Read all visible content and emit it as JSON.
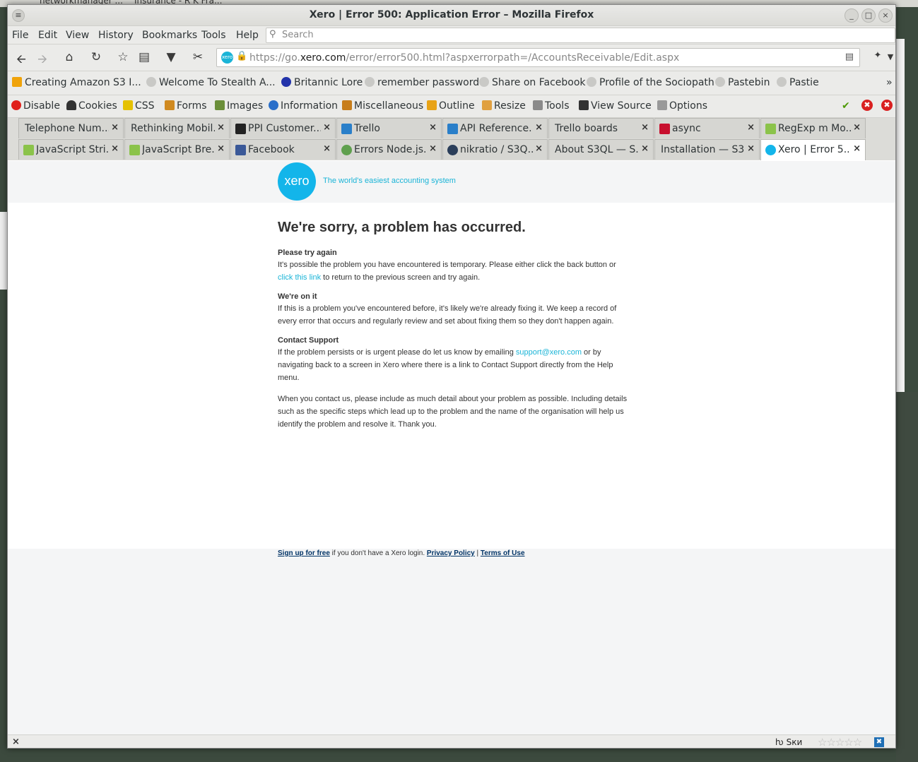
{
  "desktop": {
    "bg_items": [
      "networkmanager ...",
      "Insurance - R K Fra..."
    ]
  },
  "window": {
    "title": "Xero | Error 500: Application Error – Mozilla Firefox",
    "menu_icon": "≡",
    "controls": [
      "_",
      "□",
      "×"
    ]
  },
  "menubar": {
    "items": [
      "File",
      "Edit",
      "View",
      "History",
      "Bookmarks",
      "Tools",
      "Help"
    ],
    "search_placeholder": "Search",
    "search_icon": "magnifier-icon"
  },
  "navbar": {
    "buttons": [
      "back-icon",
      "forward-icon",
      "home-icon",
      "reload-icon",
      "star-icon",
      "reading-list-icon",
      "pocket-icon",
      "cut-icon"
    ],
    "url_prefix": "https://go.",
    "url_host": "xero.com",
    "url_rest": "/error/error500.html?aspxerrorpath=/AccountsReceivable/Edit.aspx",
    "site_badge": "xero"
  },
  "bookmarks": [
    "Creating Amazon S3 I...",
    "Welcome To Stealth A...",
    "Britannic Lore",
    "remember password",
    "Share on Facebook",
    "Profile of the Sociopath",
    "Pastebin",
    "Pastie"
  ],
  "bookmarks_overflow": "»",
  "devbar": {
    "items": [
      "Disable",
      "Cookies",
      "CSS",
      "Forms",
      "Images",
      "Information",
      "Miscellaneous",
      "Outline",
      "Resize",
      "Tools",
      "View Source",
      "Options"
    ]
  },
  "tabs_row1": [
    "Telephone Num...",
    "Rethinking Mobil...",
    "PPI Customer...",
    "Trello",
    "API Reference...",
    "Trello boards",
    "async",
    "RegExp m Mo..."
  ],
  "tabs_row2": [
    "JavaScript Stri...",
    "JavaScript Bre...",
    "Facebook",
    "Errors Node.js...",
    "nikratio / S3Q...",
    "About S3QL — S...",
    "Installation — S3...",
    "Xero | Error 5..."
  ],
  "tab_close": "×",
  "page": {
    "logo_text": "xero",
    "tagline": "The world's easiest accounting system",
    "heading": "We're sorry, a problem has occurred.",
    "s1_title": "Please try again",
    "s1_text_a": "It's possible the problem you have encountered is temporary. Please either click the back button or ",
    "s1_link": "click this link",
    "s1_text_b": " to return to the previous screen and try again.",
    "s2_title": "We're on it",
    "s2_text": "If this is a problem you've encountered before, it's likely we're already fixing it. We keep a record of every error that occurs and regularly review and set about fixing them so they don't happen again.",
    "s3_title": "Contact Support",
    "s3_text_a": "If the problem persists or is urgent please do let us know by emailing ",
    "s3_link": "support@xero.com",
    "s3_text_b": " or by navigating back to a screen in Xero where there is a link to Contact Support directly from the Help menu.",
    "s4_text": "When you contact us, please include as much detail about your problem as possible. Including details such as the specific steps which lead up to the problem and the name of the organisation will help us identify the problem and resolve it. Thank you.",
    "footer_signup": "Sign up for free",
    "footer_mid": " if you don't have a Xero login. ",
    "footer_privacy": "Privacy Policy",
    "footer_sep": " | ",
    "footer_terms": "Terms of Use"
  },
  "statusbar": {
    "close": "×",
    "lang": "ƕ Ѕки",
    "stars": "☆☆☆☆☆"
  },
  "colors": {
    "xero_blue": "#13b5ea",
    "link": "#1ab4d7",
    "footer_link": "#003366"
  }
}
